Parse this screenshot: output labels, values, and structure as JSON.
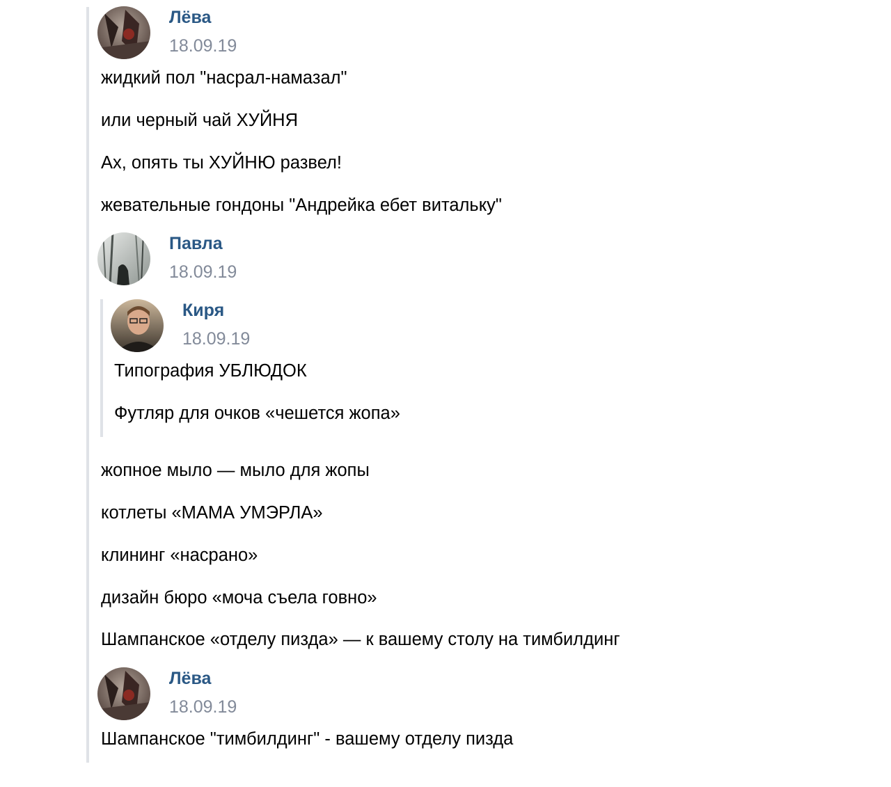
{
  "messages": [
    {
      "author": "Лёва",
      "date": "18.09.19",
      "avatar": "avatar-leva",
      "lines": [
        "жидкий пол \"насрал-намазал\"",
        "или черный чай ХУЙНЯ",
        "Ах, опять ты ХУЙНЮ развел!",
        "жевательные гондоны \"Андрейка ебет витальку\""
      ]
    },
    {
      "author": "Павла",
      "date": "18.09.19",
      "avatar": "avatar-pavla",
      "quote": {
        "author": "Киря",
        "date": "18.09.19",
        "avatar": "avatar-kirya",
        "lines": [
          "Типография УБЛЮДОК",
          "Футляр для очков «чешется жопа»"
        ]
      },
      "lines": [
        "жопное мыло — мыло для жопы",
        "котлеты «МАМА УМЭРЛА»",
        "клининг «насрано»",
        "дизайн бюро «моча съела говно»",
        "Шампанское «отделу пизда» — к вашему столу на тимбилдинг"
      ]
    },
    {
      "author": "Лёва",
      "date": "18.09.19",
      "avatar": "avatar-leva",
      "lines": [
        "Шампанское \"тимбилдинг\" - вашему отделу пизда"
      ]
    }
  ],
  "colors": {
    "author_link": "#2a5885",
    "date": "#828a99",
    "thread_border": "#dfe2e7",
    "text": "#000000"
  }
}
